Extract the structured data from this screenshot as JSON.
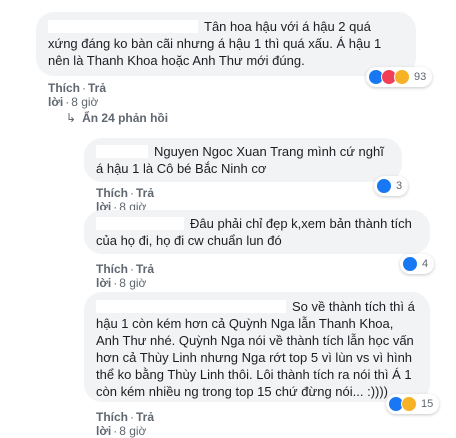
{
  "comments": [
    {
      "text": "Tân hoa hậu với á hậu 2 quá xứng đáng ko bàn cãi nhưng á hậu 1 thì quá xấu. Á hậu 1 nên là Thanh Khoa hoặc Anh Thư mới đúng.",
      "like_label": "Thích",
      "reply_label": "Trả lời",
      "time": "8 giờ",
      "reactions": [
        "like-icon",
        "heart-icon",
        "haha-icon"
      ],
      "reaction_count": "93"
    }
  ],
  "hidden_replies": "Ẩn 24 phản hồi",
  "replies": [
    {
      "text": "Nguyen Ngoc Xuan Trang mình cứ nghĩ á hậu 1 là Cô bé Bắc Ninh cơ",
      "like_label": "Thích",
      "reply_label": "Trả lời",
      "time": "8 giờ",
      "reactions": [
        "like-icon"
      ],
      "reaction_count": "3"
    },
    {
      "text": "Đâu phải chỉ đẹp k,xem bản thành tích của họ đi, họ đi cw chuẩn lun đó",
      "like_label": "Thích",
      "reply_label": "Trả lời",
      "time": "8 giờ",
      "reactions": [
        "like-icon"
      ],
      "reaction_count": "4"
    },
    {
      "text": "So về thành tích thì á hậu 1 còn kém hơn cả Quỳnh Nga lẫn Thanh Khoa, Anh Thư nhé. Quỳnh Nga nói về thành tích lẫn học vấn hơn cả Thùy Linh nhưng Nga rớt top 5 vì lùn vs vì hình thể ko bằng Thùy Linh thôi. Lôi thành tích ra nói thì Á 1 còn kém nhiều ng trong top 15 chứ đừng nói... :))))",
      "like_label": "Thích",
      "reply_label": "Trả lời",
      "time": "8 giờ",
      "reactions": [
        "like-icon",
        "haha-icon"
      ],
      "reaction_count": "15"
    }
  ],
  "colors": {
    "bubble": "#f2f3f5",
    "meta_text": "#606770",
    "like": "#1877f2",
    "heart": "#f33e58",
    "haha": "#f7b125"
  }
}
